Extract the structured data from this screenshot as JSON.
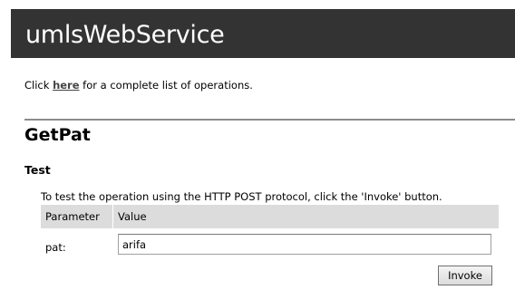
{
  "header": {
    "title": "umlsWebService"
  },
  "intro": {
    "prefix": "Click ",
    "link_text": "here",
    "suffix": " for a complete list of operations."
  },
  "operation": {
    "name": "GetPat",
    "test_heading": "Test",
    "test_description": "To test the operation using the HTTP POST protocol, click the 'Invoke' button.",
    "table": {
      "columns": [
        "Parameter",
        "Value"
      ],
      "rows": [
        {
          "label": "pat:",
          "value": "arifa"
        }
      ]
    },
    "invoke_label": "Invoke"
  },
  "colors": {
    "header_bg": "#333333",
    "header_text": "#ffffff",
    "table_header_bg": "#dcdcdc",
    "rule": "#8c8c8c"
  }
}
